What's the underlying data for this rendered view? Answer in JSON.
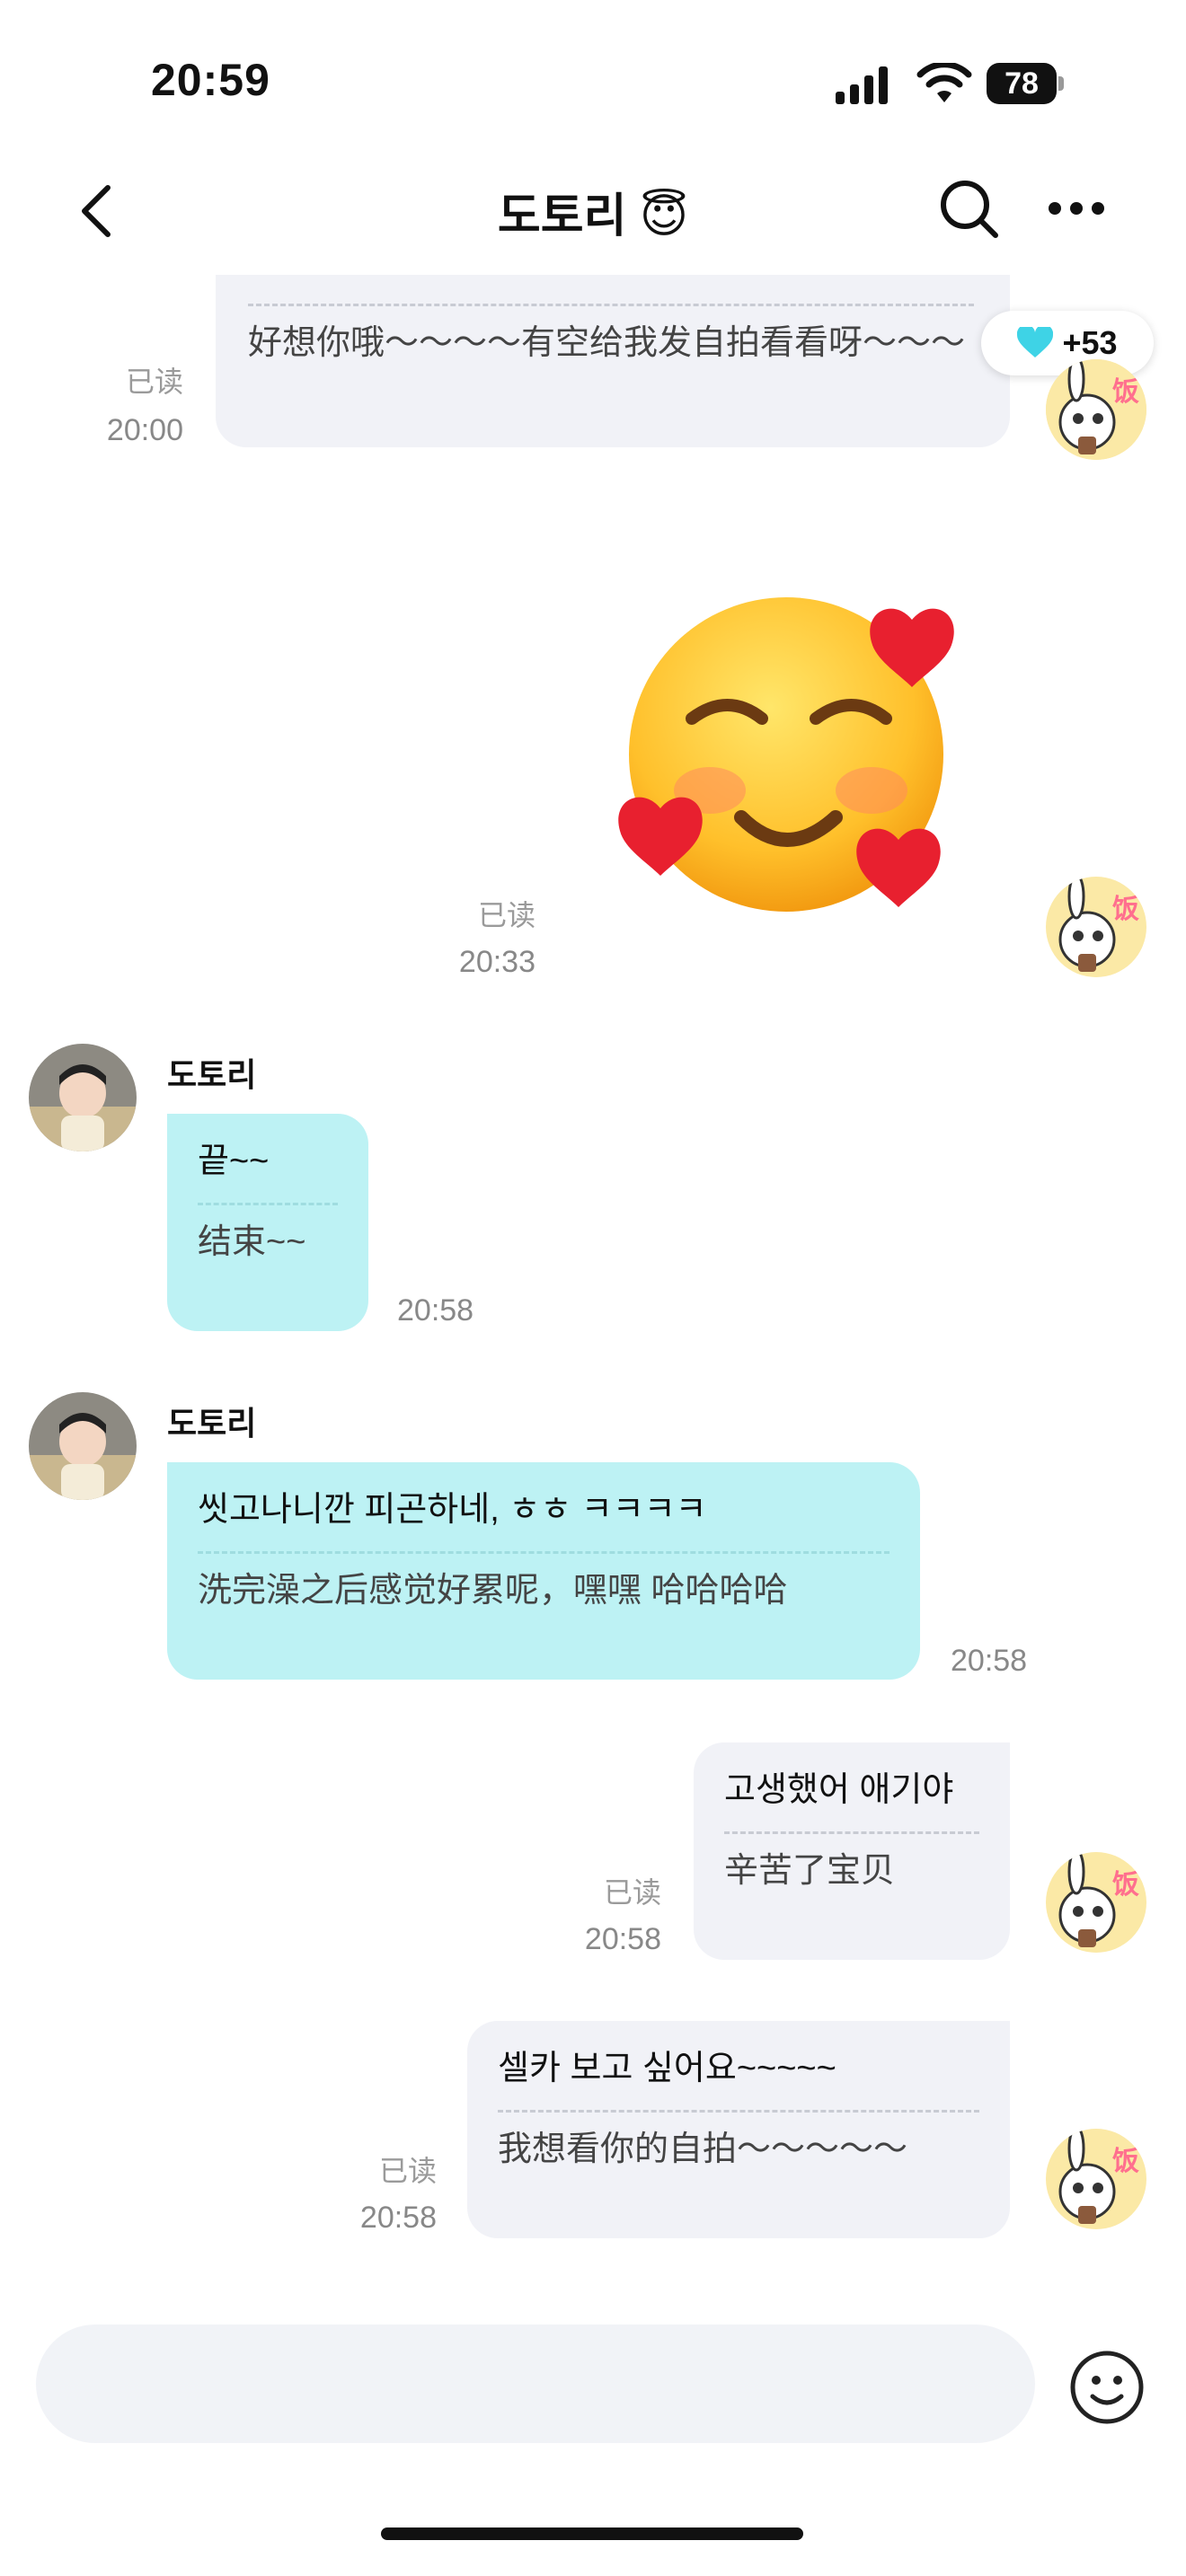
{
  "status_bar": {
    "time": "20:59",
    "battery": "78"
  },
  "header": {
    "title": "도토리 😇"
  },
  "badge": {
    "count": "+53"
  },
  "messages": {
    "m1": {
      "translation": "好想你哦～～～～有空给我发自拍看看呀～～～",
      "read": "已读",
      "time": "20:00"
    },
    "m2": {
      "read": "已读",
      "time": "20:33"
    },
    "m3": {
      "sender": "도토리",
      "original": "끝~~",
      "translation": "结束~~",
      "time": "20:58"
    },
    "m4": {
      "sender": "도토리",
      "original": "씻고나니깐 피곤하네, ㅎㅎ ㅋㅋㅋㅋ",
      "translation": "洗完澡之后感觉好累呢，嘿嘿 哈哈哈哈",
      "time": "20:58"
    },
    "m5": {
      "original": "고생했어 애기야",
      "translation": "辛苦了宝贝",
      "read": "已读",
      "time": "20:58"
    },
    "m6": {
      "original": "셀카 보고 싶어요~~~~~",
      "translation": "我想看你的自拍～～～～～",
      "read": "已读",
      "time": "20:58"
    }
  },
  "colors": {
    "their_bubble": "#bdf2f4",
    "my_bubble": "#f1f2f7",
    "heart_badge": "#3ed3e6"
  },
  "icons": [
    "back-chevron-icon",
    "search-icon",
    "more-icon",
    "diamond-heart-icon",
    "emoji-icon",
    "smiling-face-with-hearts-icon"
  ]
}
